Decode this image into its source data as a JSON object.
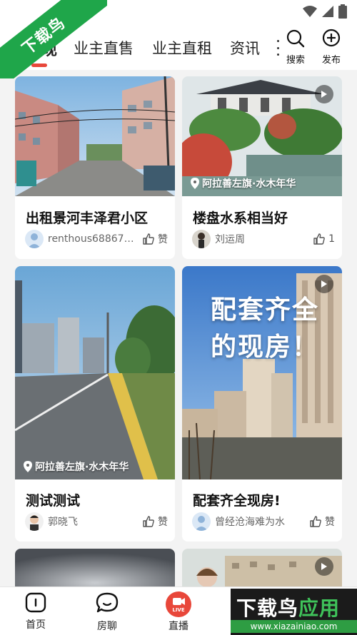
{
  "watermark": {
    "text": "下载鸟"
  },
  "tabs": [
    {
      "label": "发现"
    },
    {
      "label": "业主直售"
    },
    {
      "label": "业主直租"
    },
    {
      "label": "资讯"
    }
  ],
  "actions": {
    "search_label": "搜索",
    "publish_label": "发布"
  },
  "cards": [
    {
      "title": "出租景河丰泽君小区",
      "author": "renthous68867…",
      "likes": "赞",
      "location": "",
      "has_play": false
    },
    {
      "title": "楼盘水系相当好",
      "author": "刘运周",
      "likes": "1",
      "location": "阿拉善左旗·水木年华",
      "has_play": true
    },
    {
      "title": "测试测试",
      "author": "郭晓飞",
      "likes": "赞",
      "location": "阿拉善左旗·水木年华",
      "has_play": false
    },
    {
      "title": "配套齐全现房!",
      "author": "曾经沧海难为水",
      "likes": "赞",
      "location": "",
      "has_play": true,
      "overlay_lines": [
        "配套齐全",
        "的现房！"
      ]
    }
  ],
  "bottom_nav": {
    "home_label": "首页",
    "chat_label": "房聊",
    "live_label": "直播",
    "live_badge": "LIVE"
  },
  "logo_overlay": {
    "main_a": "下载鸟",
    "main_b": "应用",
    "sub": "www.xiazainiao.com"
  },
  "colors": {
    "accent": "#e8473a",
    "watermark_green": "#1fa64a"
  }
}
